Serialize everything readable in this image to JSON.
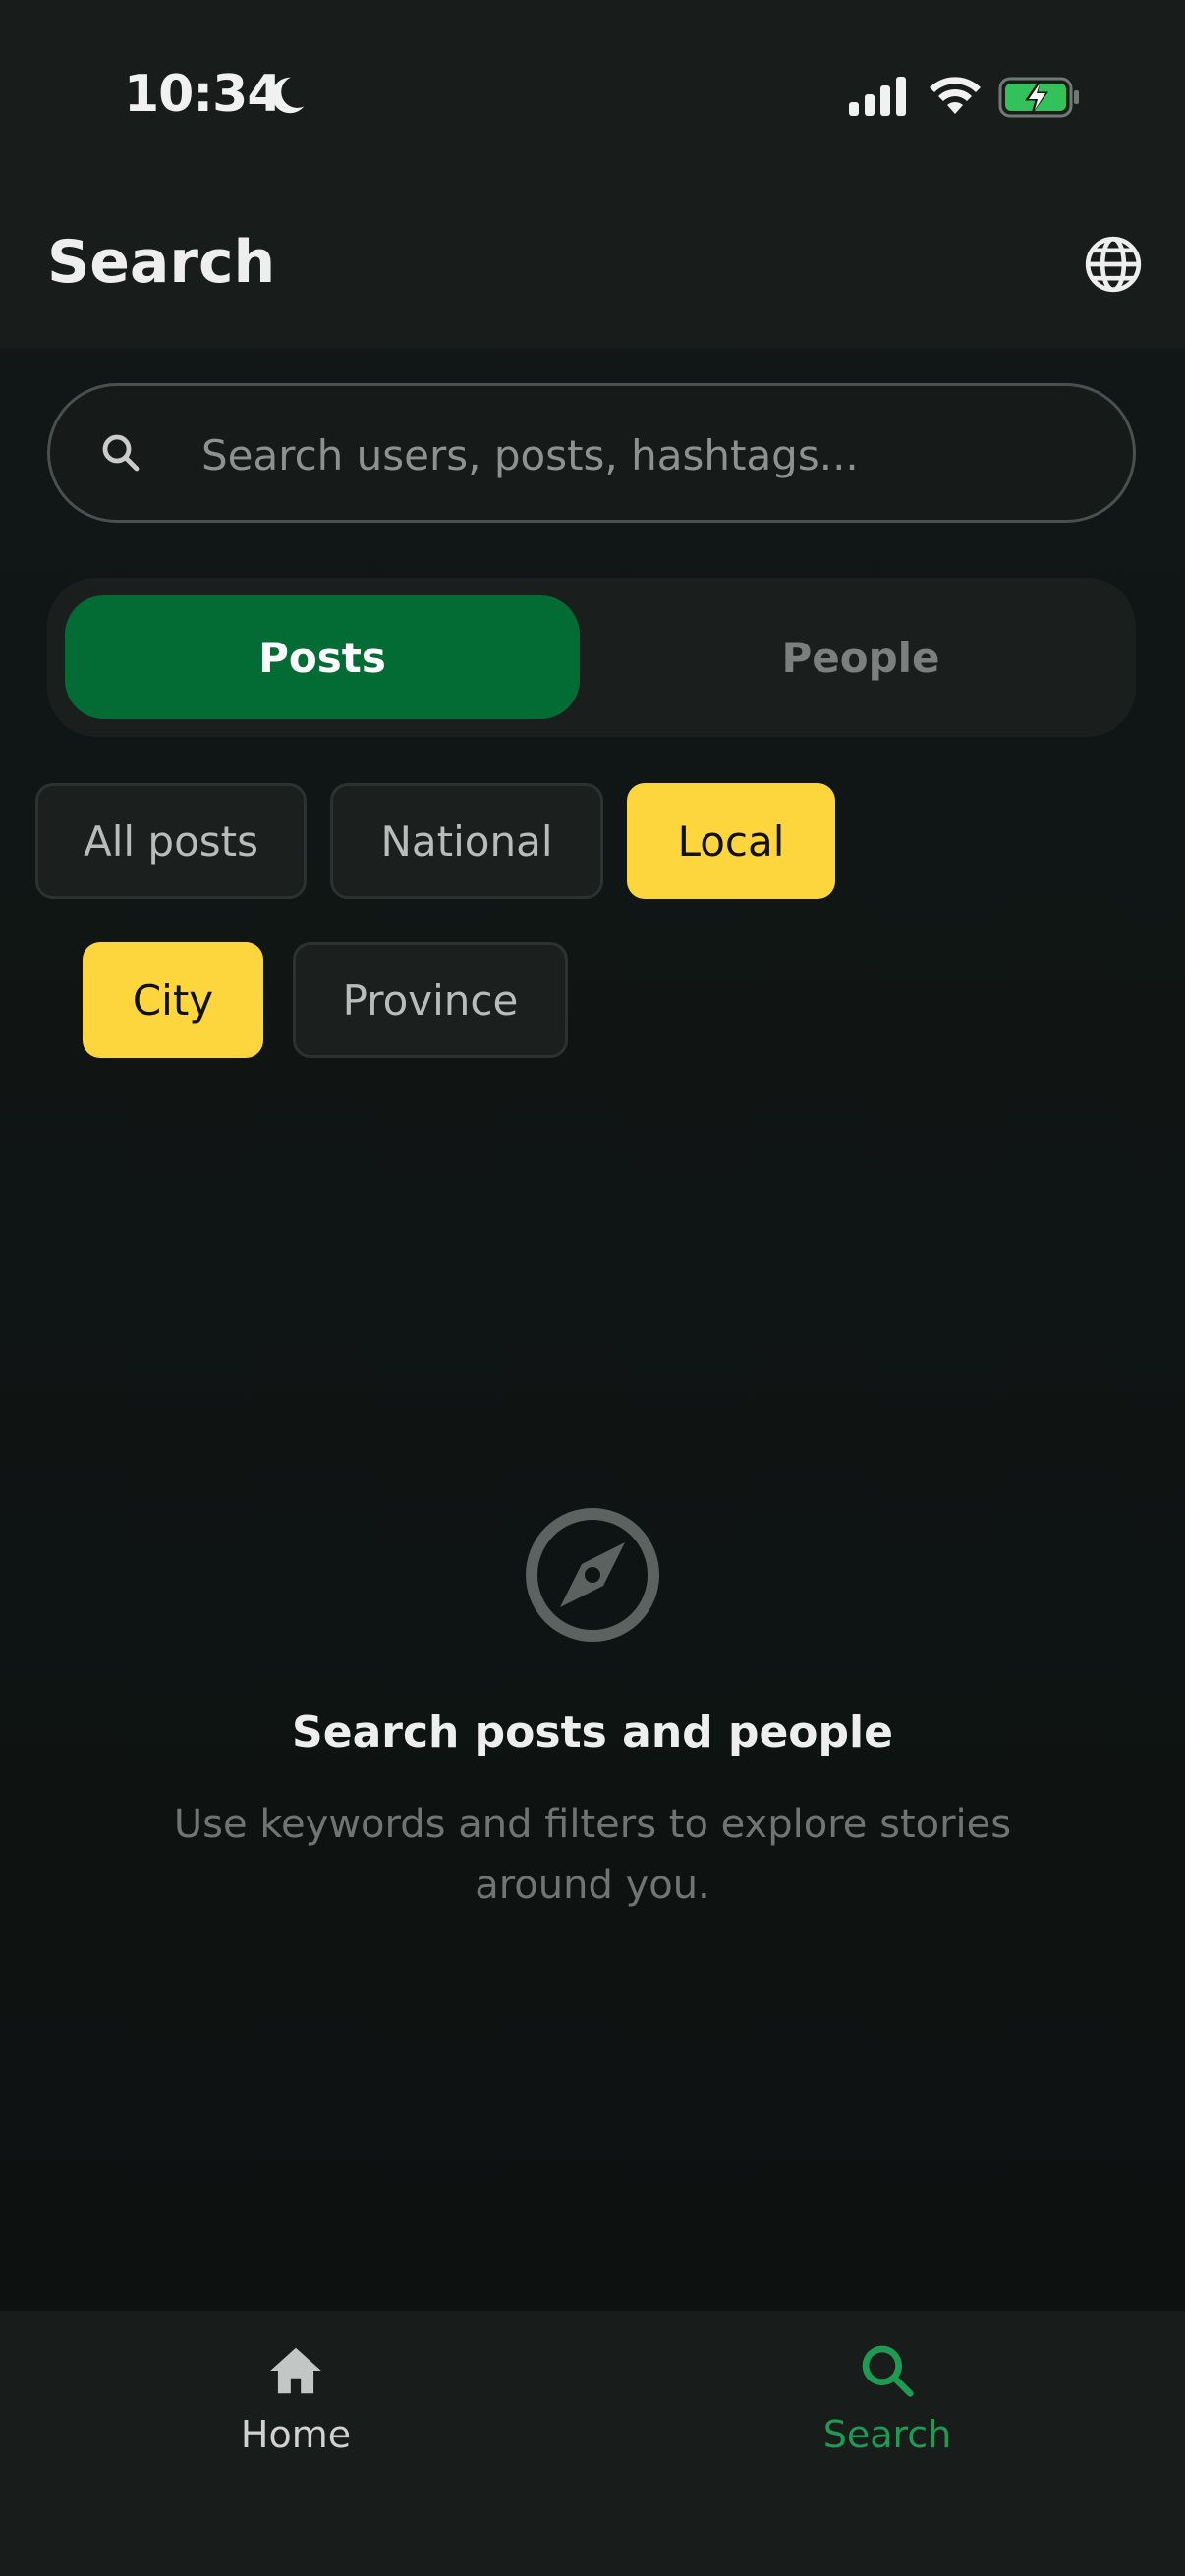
{
  "status_bar": {
    "time": "10:34"
  },
  "header": {
    "title": "Search"
  },
  "search": {
    "placeholder": "Search users, posts, hashtags..."
  },
  "segments": [
    {
      "label": "Posts",
      "active": true
    },
    {
      "label": "People",
      "active": false
    }
  ],
  "filters_primary": [
    {
      "label": "All posts",
      "active": false
    },
    {
      "label": "National",
      "active": false
    },
    {
      "label": "Local",
      "active": true
    }
  ],
  "filters_secondary": [
    {
      "label": "City",
      "active": true
    },
    {
      "label": "Province",
      "active": false
    }
  ],
  "empty_state": {
    "title": "Search posts and people",
    "text": "Use keywords and filters to explore stories around you."
  },
  "bottom_nav": [
    {
      "label": "Home",
      "icon": "home-icon",
      "active": false
    },
    {
      "label": "Search",
      "icon": "search-icon",
      "active": true
    }
  ],
  "colors": {
    "accent_green": "#036c34",
    "accent_yellow": "#fdd53d",
    "nav_active": "#1f9a52"
  }
}
